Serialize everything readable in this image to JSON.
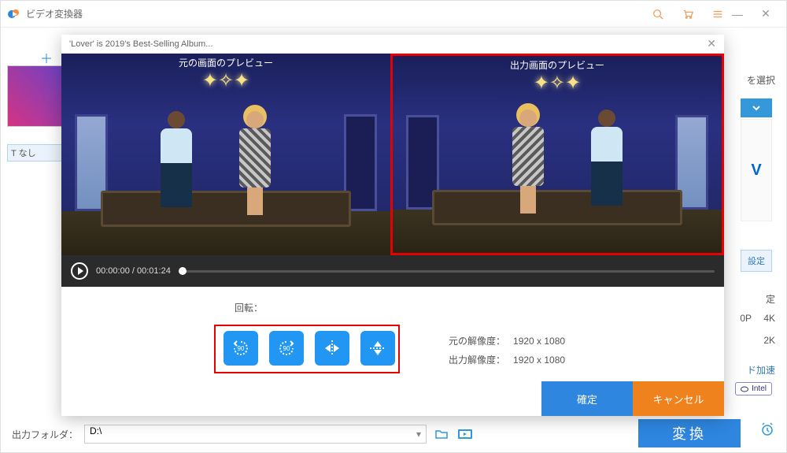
{
  "main": {
    "title": "ビデオ変換器",
    "side_label": "T なし",
    "select_hint": "を選択",
    "setting_hint": "設定",
    "res_hint": "定",
    "res_p": "0P",
    "res_4k": "4K",
    "res_2k": "2K",
    "accel": "ド加速",
    "intel": "Intel",
    "format_box": "V",
    "output_folder_label": "出力フォルダ：",
    "output_folder_value": "D:\\",
    "convert_label": "変換"
  },
  "modal": {
    "head": "'Lover' is 2019's Best-Selling Album...",
    "left_title": "元の画面のプレビュー",
    "right_title": "出力画面のプレビュー",
    "time_current": "00:00:00",
    "time_total": "00:01:24",
    "rotate_label": "回転：",
    "orig_res_label": "元の解像度：",
    "orig_res_value": "1920 x 1080",
    "out_res_label": "出力解像度：",
    "out_res_value": "1920 x 1080",
    "ok": "確定",
    "cancel": "キャンセル"
  }
}
